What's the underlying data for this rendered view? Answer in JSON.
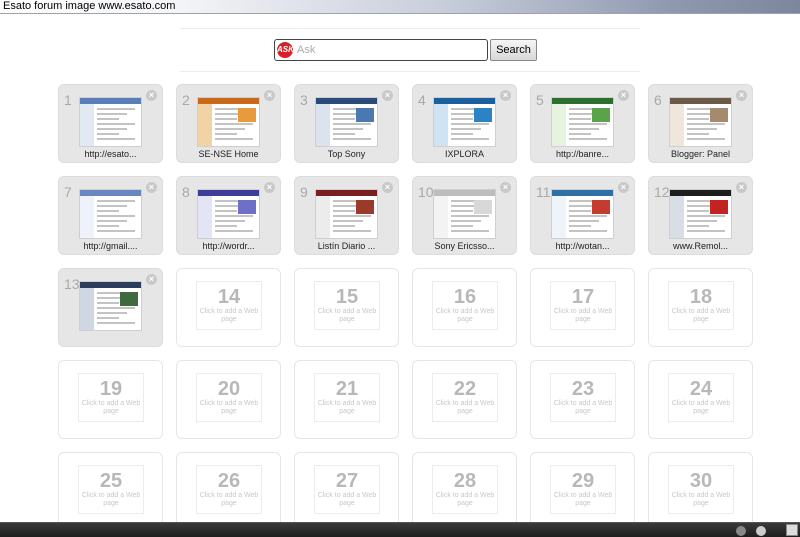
{
  "window": {
    "title": "Esato forum image www.esato.com"
  },
  "search": {
    "placeholder": "Ask",
    "button_label": "Search",
    "logo_text": "ASK"
  },
  "tiles": [
    {
      "number": "1",
      "label": "http://esato...",
      "empty_text": ""
    },
    {
      "number": "2",
      "label": "SE-NSE Home",
      "empty_text": ""
    },
    {
      "number": "3",
      "label": "Top Sony",
      "empty_text": ""
    },
    {
      "number": "4",
      "label": "IXPLORA",
      "empty_text": ""
    },
    {
      "number": "5",
      "label": "http://banre...",
      "empty_text": ""
    },
    {
      "number": "6",
      "label": "Blogger: Panel",
      "empty_text": ""
    },
    {
      "number": "7",
      "label": "http://gmail....",
      "empty_text": ""
    },
    {
      "number": "8",
      "label": "http://wordr...",
      "empty_text": ""
    },
    {
      "number": "9",
      "label": "Listín Diario ...",
      "empty_text": ""
    },
    {
      "number": "10",
      "label": "Sony Ericsso...",
      "empty_text": ""
    },
    {
      "number": "11",
      "label": "http://wotan...",
      "empty_text": ""
    },
    {
      "number": "12",
      "label": "www.Remol...",
      "empty_text": ""
    },
    {
      "number": "13",
      "label": "",
      "empty_text": ""
    },
    {
      "number": "14",
      "label": "",
      "empty_text": "Click to add a Web page"
    },
    {
      "number": "15",
      "label": "",
      "empty_text": "Click to add a Web page"
    },
    {
      "number": "16",
      "label": "",
      "empty_text": "Click to add a Web page"
    },
    {
      "number": "17",
      "label": "",
      "empty_text": "Click to add a Web page"
    },
    {
      "number": "18",
      "label": "",
      "empty_text": "Click to add a Web page"
    },
    {
      "number": "19",
      "label": "",
      "empty_text": "Click to add a Web page"
    },
    {
      "number": "20",
      "label": "",
      "empty_text": "Click to add a Web page"
    },
    {
      "number": "21",
      "label": "",
      "empty_text": "Click to add a Web page"
    },
    {
      "number": "22",
      "label": "",
      "empty_text": "Click to add a Web page"
    },
    {
      "number": "23",
      "label": "",
      "empty_text": "Click to add a Web page"
    },
    {
      "number": "24",
      "label": "",
      "empty_text": "Click to add a Web page"
    },
    {
      "number": "25",
      "label": "",
      "empty_text": "Click to add a Web page"
    },
    {
      "number": "26",
      "label": "",
      "empty_text": "Click to add a Web page"
    },
    {
      "number": "27",
      "label": "",
      "empty_text": "Click to add a Web page"
    },
    {
      "number": "28",
      "label": "",
      "empty_text": "Click to add a Web page"
    },
    {
      "number": "29",
      "label": "",
      "empty_text": "Click to add a Web page"
    },
    {
      "number": "30",
      "label": "",
      "empty_text": "Click to add a Web page"
    }
  ],
  "colors": {
    "accent": "#d6202a",
    "tile_bg": "#e6e6e6",
    "slot_number": "#b8b8b8"
  }
}
